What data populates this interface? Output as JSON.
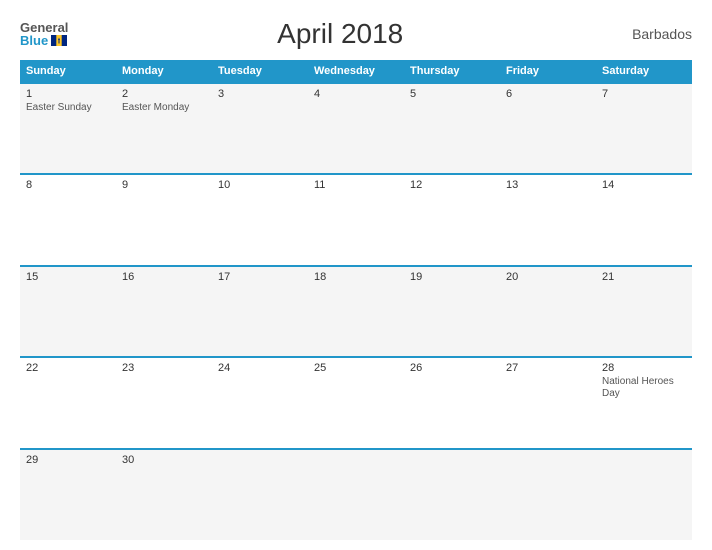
{
  "header": {
    "logo_general": "General",
    "logo_blue": "Blue",
    "title": "April 2018",
    "country": "Barbados"
  },
  "columns": [
    "Sunday",
    "Monday",
    "Tuesday",
    "Wednesday",
    "Thursday",
    "Friday",
    "Saturday"
  ],
  "rows": [
    [
      {
        "day": "1",
        "holiday": "Easter Sunday"
      },
      {
        "day": "2",
        "holiday": "Easter Monday"
      },
      {
        "day": "3",
        "holiday": ""
      },
      {
        "day": "4",
        "holiday": ""
      },
      {
        "day": "5",
        "holiday": ""
      },
      {
        "day": "6",
        "holiday": ""
      },
      {
        "day": "7",
        "holiday": ""
      }
    ],
    [
      {
        "day": "8",
        "holiday": ""
      },
      {
        "day": "9",
        "holiday": ""
      },
      {
        "day": "10",
        "holiday": ""
      },
      {
        "day": "11",
        "holiday": ""
      },
      {
        "day": "12",
        "holiday": ""
      },
      {
        "day": "13",
        "holiday": ""
      },
      {
        "day": "14",
        "holiday": ""
      }
    ],
    [
      {
        "day": "15",
        "holiday": ""
      },
      {
        "day": "16",
        "holiday": ""
      },
      {
        "day": "17",
        "holiday": ""
      },
      {
        "day": "18",
        "holiday": ""
      },
      {
        "day": "19",
        "holiday": ""
      },
      {
        "day": "20",
        "holiday": ""
      },
      {
        "day": "21",
        "holiday": ""
      }
    ],
    [
      {
        "day": "22",
        "holiday": ""
      },
      {
        "day": "23",
        "holiday": ""
      },
      {
        "day": "24",
        "holiday": ""
      },
      {
        "day": "25",
        "holiday": ""
      },
      {
        "day": "26",
        "holiday": ""
      },
      {
        "day": "27",
        "holiday": ""
      },
      {
        "day": "28",
        "holiday": "National Heroes Day"
      }
    ],
    [
      {
        "day": "29",
        "holiday": ""
      },
      {
        "day": "30",
        "holiday": ""
      },
      {
        "day": "",
        "holiday": ""
      },
      {
        "day": "",
        "holiday": ""
      },
      {
        "day": "",
        "holiday": ""
      },
      {
        "day": "",
        "holiday": ""
      },
      {
        "day": "",
        "holiday": ""
      }
    ]
  ]
}
